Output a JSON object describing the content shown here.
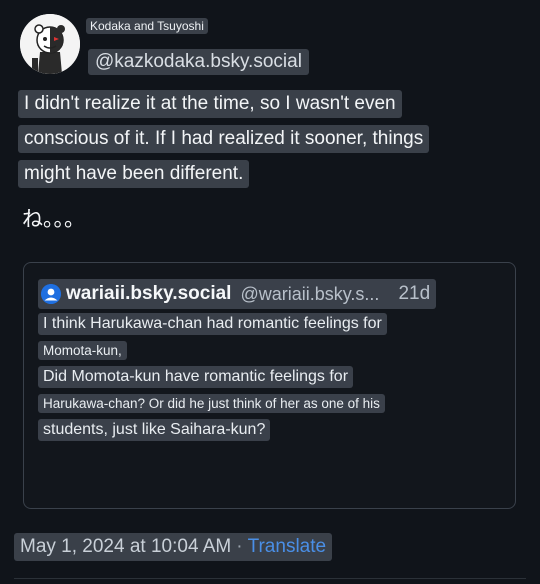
{
  "author": {
    "display_name": "Kodaka and Tsuyoshi",
    "handle": "@kazkodaka.bsky.social"
  },
  "post": {
    "lines": [
      "I didn't realize it at the time, so I wasn't even",
      "conscious of it. If I had realized it sooner, things",
      "might have been different."
    ],
    "trailing_jp": "ね。。。"
  },
  "quote": {
    "name": "wariaii.bsky.social",
    "handle": "@wariaii.bsky.s...",
    "time": "21d",
    "lines": [
      {
        "text": "I think Harukawa-chan had romantic feelings for",
        "size": "l"
      },
      {
        "text": "Momota-kun,",
        "size": "s"
      },
      {
        "text": "Did Momota-kun have romantic feelings for",
        "size": "l"
      },
      {
        "text": "Harukawa-chan? Or did he just think of her as one of his",
        "size": "s"
      },
      {
        "text": "students, just like Saihara-kun?",
        "size": "l"
      }
    ]
  },
  "footer": {
    "timestamp": "May 1, 2024 at 10:04 AM",
    "separator": "·",
    "translate_label": "Translate"
  },
  "colors": {
    "background": "#10141a",
    "link": "#4a8fe7",
    "avatar_bg": "#1f6fe0"
  },
  "icons": {
    "author_avatar": "monochrome-bear-avatar",
    "quote_avatar": "default-user-icon"
  }
}
